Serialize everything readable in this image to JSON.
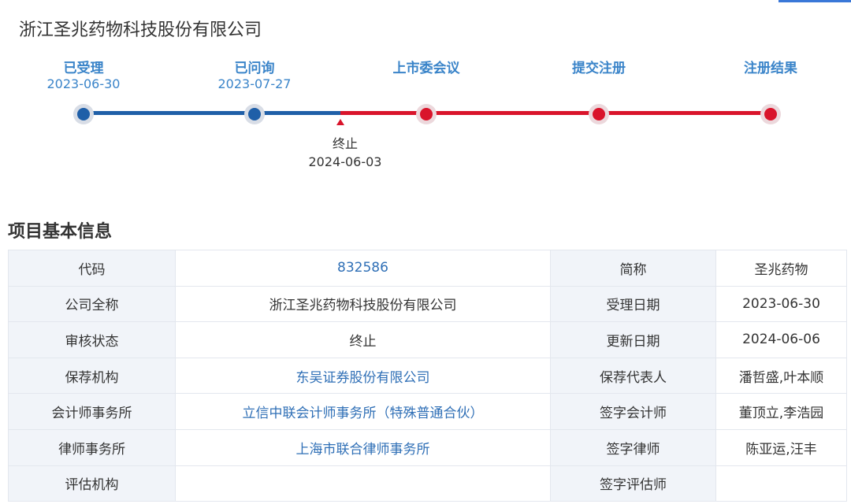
{
  "company": {
    "title": "浙江圣兆药物科技股份有限公司"
  },
  "timeline": {
    "stages": [
      {
        "label": "已受理",
        "date": "2023-06-30",
        "status": "done"
      },
      {
        "label": "已问询",
        "date": "2023-07-27",
        "status": "done"
      },
      {
        "label": "上市委会议",
        "date": "",
        "status": "pending"
      },
      {
        "label": "提交注册",
        "date": "",
        "status": "pending"
      },
      {
        "label": "注册结果",
        "date": "",
        "status": "pending"
      }
    ],
    "stop": {
      "label": "终止",
      "date": "2024-06-03"
    },
    "colors": {
      "done": "#1f5fa8",
      "pending": "#d9142b",
      "label": "#3a84c9"
    }
  },
  "info": {
    "section_title": "项目基本信息",
    "rows": [
      {
        "l1": "代码",
        "v1": "832586",
        "l2": "简称",
        "v2": "圣兆药物"
      },
      {
        "l1": "公司全称",
        "v1": "浙江圣兆药物科技股份有限公司",
        "l2": "受理日期",
        "v2": "2023-06-30"
      },
      {
        "l1": "审核状态",
        "v1": "终止",
        "l2": "更新日期",
        "v2": "2024-06-06"
      },
      {
        "l1": "保荐机构",
        "v1": "东吴证券股份有限公司",
        "l2": "保荐代表人",
        "v2": "潘哲盛,叶本顺"
      },
      {
        "l1": "会计师事务所",
        "v1": "立信中联会计师事务所（特殊普通合伙）",
        "l2": "签字会计师",
        "v2": "董顶立,李浩园"
      },
      {
        "l1": "律师事务所",
        "v1": "上海市联合律师事务所",
        "l2": "签字律师",
        "v2": "陈亚运,汪丰"
      },
      {
        "l1": "评估机构",
        "v1": "",
        "l2": "签字评估师",
        "v2": ""
      }
    ]
  }
}
